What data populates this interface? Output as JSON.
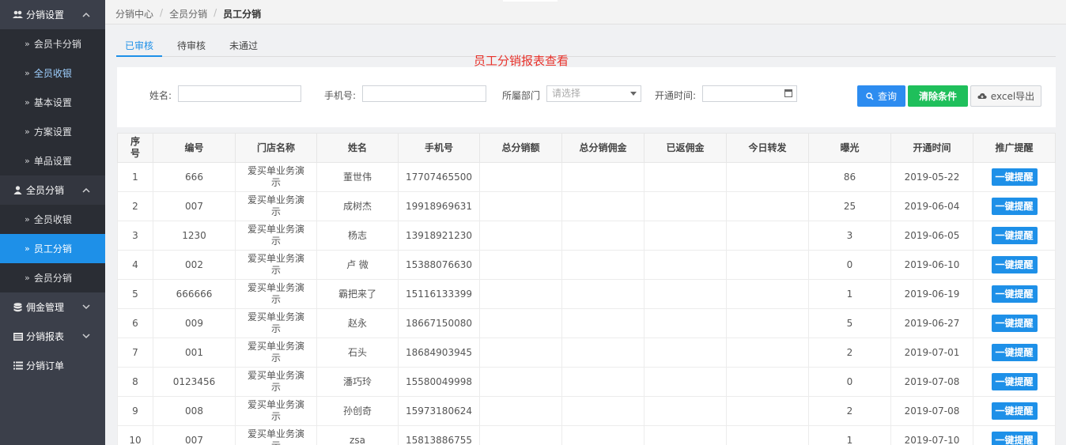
{
  "sidebar": {
    "groups": [
      {
        "label": "分销设置",
        "icon": "users-icon",
        "expanded": true,
        "items": [
          "会员卡分销",
          "全员收银",
          "基本设置",
          "方案设置",
          "单品设置"
        ]
      },
      {
        "label": "全员分销",
        "icon": "user-icon",
        "expanded": true,
        "items": [
          "全员收银",
          "员工分销",
          "会员分销"
        ]
      },
      {
        "label": "佣金管理",
        "icon": "database-icon",
        "expanded": false
      },
      {
        "label": "分销报表",
        "icon": "report-icon",
        "expanded": false
      },
      {
        "label": "分销订单",
        "icon": "list-icon",
        "expanded": false
      }
    ],
    "active_item": "员工分销"
  },
  "breadcrumb": [
    "分销中心",
    "全员分销",
    "员工分销"
  ],
  "tabs": [
    "已审核",
    "待审核",
    "未通过"
  ],
  "report_title": "员工分销报表查看",
  "filter": {
    "name_label": "姓名:",
    "phone_label": "手机号:",
    "dept_label": "所屬部门",
    "dept_placeholder": "请选择",
    "open_time_label": "开通时间:",
    "query_button": "查询",
    "clear_button": "清除条件",
    "export_button": "excel导出"
  },
  "table": {
    "headers": [
      "序号",
      "编号",
      "门店名称",
      "姓名",
      "手机号",
      "总分销额",
      "总分销佣金",
      "已返佣金",
      "今日转发",
      "曝光",
      "开通时间",
      "推广提醒"
    ],
    "remind_label": "一键提醒",
    "rows": [
      {
        "no": "1",
        "code": "666",
        "store": "爱买单业务演示",
        "name": "董世伟",
        "phone": "17707465500",
        "total": "",
        "commission": "",
        "returned": "",
        "today": "",
        "exposure": "86",
        "open_time": "2019-05-22"
      },
      {
        "no": "2",
        "code": "007",
        "store": "爱买单业务演示",
        "name": "成树杰",
        "phone": "19918969631",
        "total": "",
        "commission": "",
        "returned": "",
        "today": "",
        "exposure": "25",
        "open_time": "2019-06-04"
      },
      {
        "no": "3",
        "code": "1230",
        "store": "爱买单业务演示",
        "name": "杨志",
        "phone": "13918921230",
        "total": "",
        "commission": "",
        "returned": "",
        "today": "",
        "exposure": "3",
        "open_time": "2019-06-05"
      },
      {
        "no": "4",
        "code": "002",
        "store": "爱买单业务演示",
        "name": "卢 微",
        "phone": "15388076630",
        "total": "",
        "commission": "",
        "returned": "",
        "today": "",
        "exposure": "0",
        "open_time": "2019-06-10"
      },
      {
        "no": "5",
        "code": "666666",
        "store": "爱买单业务演示",
        "name": "霸把来了",
        "phone": "15116133399",
        "total": "",
        "commission": "",
        "returned": "",
        "today": "",
        "exposure": "1",
        "open_time": "2019-06-19"
      },
      {
        "no": "6",
        "code": "009",
        "store": "爱买单业务演示",
        "name": "赵永",
        "phone": "18667150080",
        "total": "",
        "commission": "",
        "returned": "",
        "today": "",
        "exposure": "5",
        "open_time": "2019-06-27"
      },
      {
        "no": "7",
        "code": "001",
        "store": "爱买单业务演示",
        "name": "石头",
        "phone": "18684903945",
        "total": "",
        "commission": "",
        "returned": "",
        "today": "",
        "exposure": "2",
        "open_time": "2019-07-01"
      },
      {
        "no": "8",
        "code": "0123456",
        "store": "爱买单业务演示",
        "name": "潘巧玲",
        "phone": "15580049998",
        "total": "",
        "commission": "",
        "returned": "",
        "today": "",
        "exposure": "0",
        "open_time": "2019-07-08"
      },
      {
        "no": "9",
        "code": "008",
        "store": "爱买单业务演示",
        "name": "孙创奇",
        "phone": "15973180624",
        "total": "",
        "commission": "",
        "returned": "",
        "today": "",
        "exposure": "2",
        "open_time": "2019-07-08"
      },
      {
        "no": "10",
        "code": "007",
        "store": "爱买单业务演示",
        "name": "zsa",
        "phone": "15813886755",
        "total": "",
        "commission": "",
        "returned": "",
        "today": "",
        "exposure": "1",
        "open_time": "2019-07-10"
      }
    ]
  },
  "colors": {
    "primary": "#1e90e8",
    "success": "#1fbf5b",
    "title_red": "#e8322b",
    "sidebar_bg": "#3b3f4a"
  }
}
